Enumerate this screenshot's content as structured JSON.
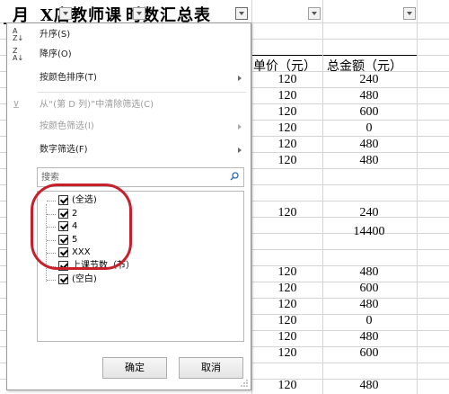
{
  "sheet": {
    "title": "_月",
    "title_rest": "X店教师课",
    "title_end": "时数汇总表",
    "headers": {
      "unit_price": "单价（元）",
      "total": "总金额（元）"
    },
    "rows": [
      {
        "price": "120",
        "total": "240"
      },
      {
        "price": "120",
        "total": "480"
      },
      {
        "price": "120",
        "total": "600"
      },
      {
        "price": "120",
        "total": "0"
      },
      {
        "price": "120",
        "total": "480"
      },
      {
        "price": "120",
        "total": "480"
      },
      {
        "price": "",
        "total": ""
      },
      {
        "price": "",
        "total": ""
      },
      {
        "price": "120",
        "total": "240"
      },
      {
        "price": "",
        "total": "14400"
      },
      {
        "price": "",
        "total": ""
      },
      {
        "price": "120",
        "total": "480"
      },
      {
        "price": "120",
        "total": "600"
      },
      {
        "price": "120",
        "total": "480"
      },
      {
        "price": "120",
        "total": "0"
      },
      {
        "price": "120",
        "total": "480"
      },
      {
        "price": "120",
        "total": "600"
      },
      {
        "price": "",
        "total": ""
      },
      {
        "price": "120",
        "total": "480"
      }
    ]
  },
  "menu": {
    "sort_asc": "升序(S)",
    "sort_desc": "降序(O)",
    "sort_by_color": "按颜色排序(T)",
    "clear_filter": "从“(第 D 列)”中清除筛选(C)",
    "filter_by_color": "按颜色筛选(I)",
    "number_filter": "数字筛选(F)",
    "icons": [
      "sort-ascending-icon",
      "sort-descending-icon",
      "clear-filter-icon",
      "search-icon"
    ]
  },
  "search": {
    "placeholder": "搜索"
  },
  "filter_list": [
    {
      "label": "(全选)",
      "checked": true
    },
    {
      "label": "2",
      "checked": true
    },
    {
      "label": "4",
      "checked": true
    },
    {
      "label": "5",
      "checked": true
    },
    {
      "label": "XXX",
      "checked": true
    },
    {
      "label": "上课节数（节）",
      "checked": true
    },
    {
      "label": "(空白)",
      "checked": true
    }
  ],
  "buttons": {
    "ok": "确定",
    "cancel": "取消"
  },
  "colors": {
    "annotation": "#c8202a"
  }
}
